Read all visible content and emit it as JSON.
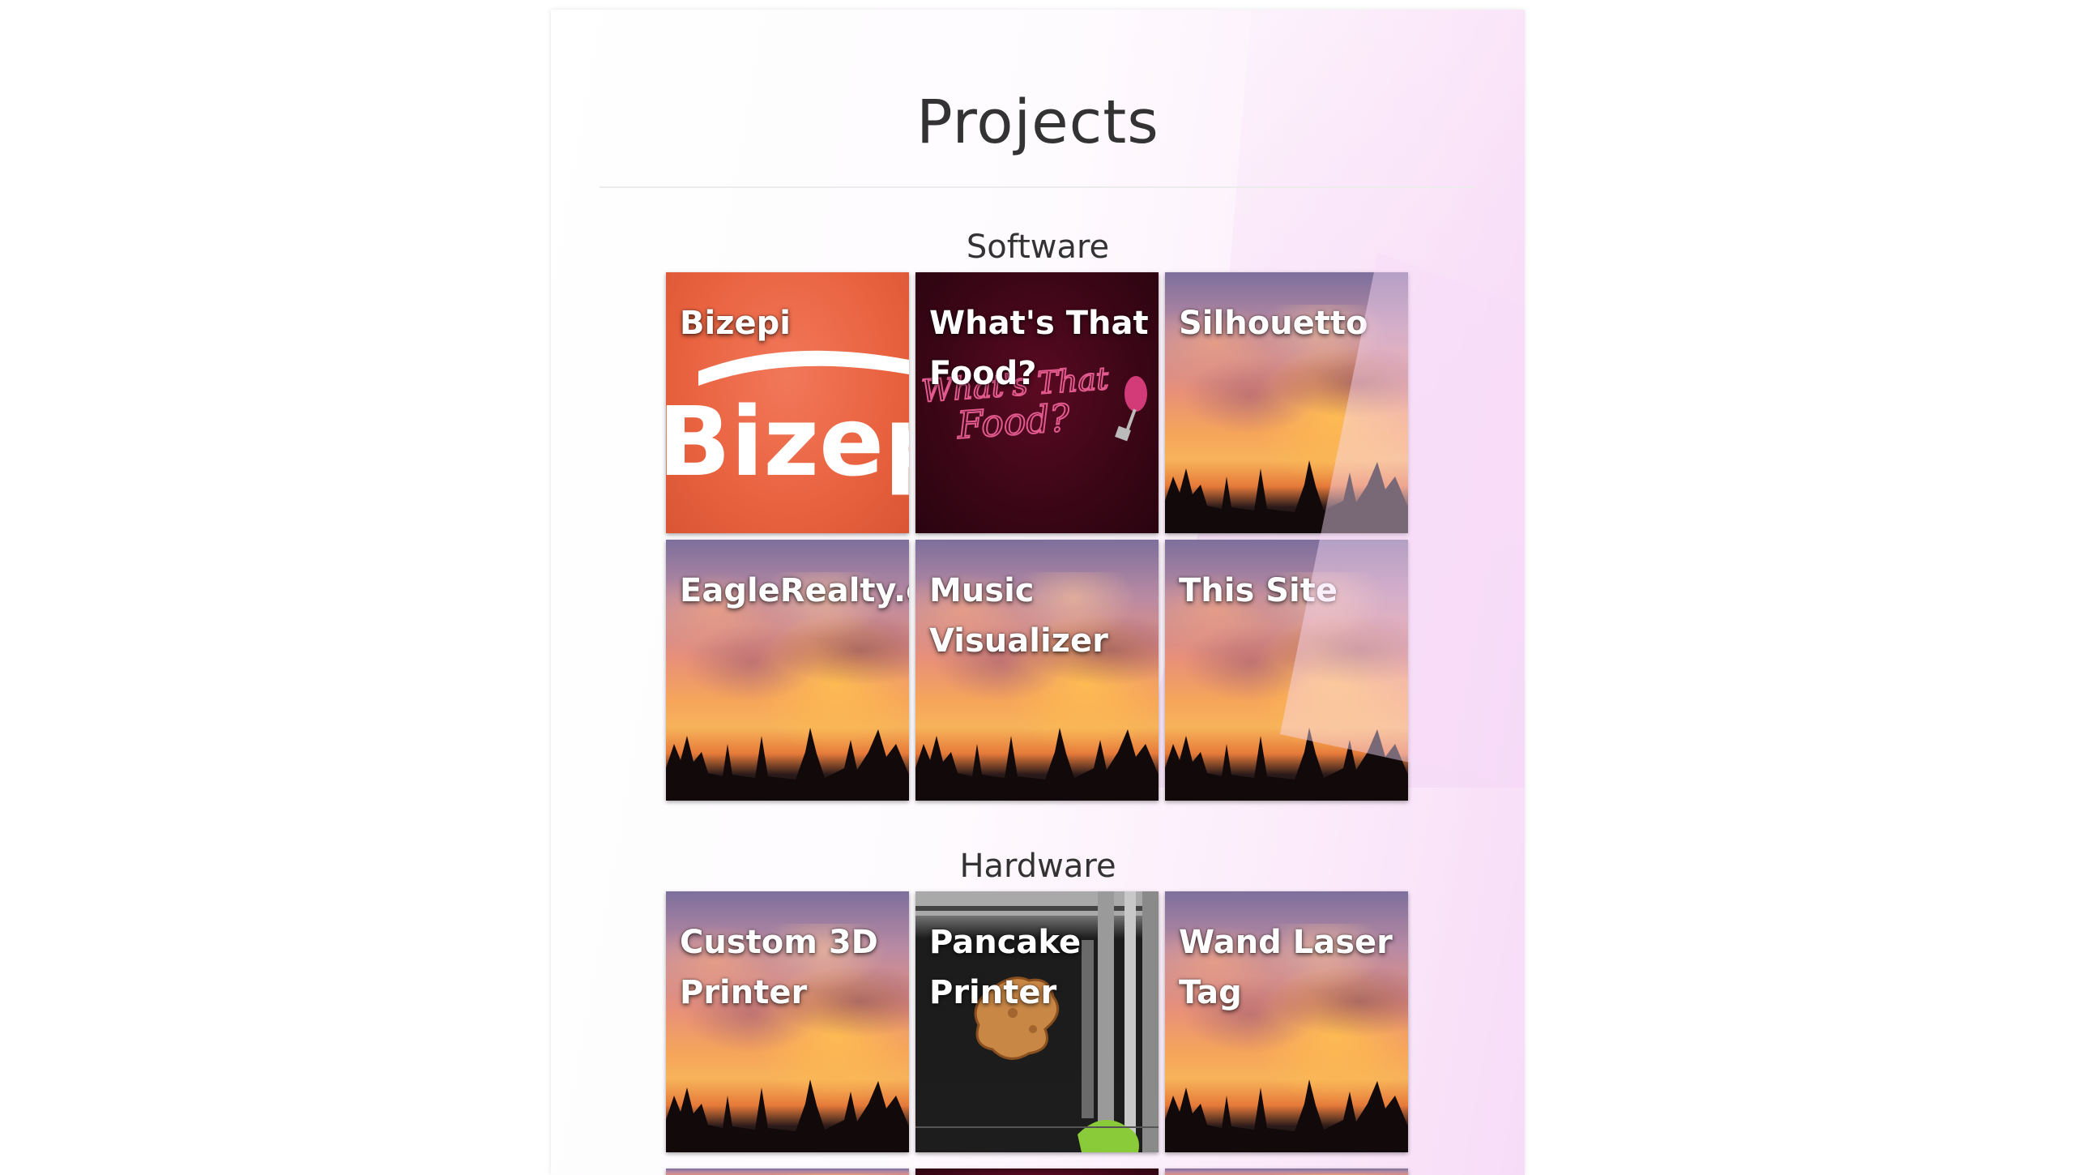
{
  "page": {
    "title": "Projects"
  },
  "sections": [
    {
      "title": "Software",
      "projects": [
        {
          "label": "Bizepi",
          "art_text": "Bizep"
        },
        {
          "label": "What's That Food?",
          "art_text_line1": "What's That",
          "art_text_line2": "Food?"
        },
        {
          "label": "Silhouetto"
        },
        {
          "label": "EagleRealty.c"
        },
        {
          "label": "Music Visualizer"
        },
        {
          "label": "This Site"
        }
      ]
    },
    {
      "title": "Hardware",
      "projects": [
        {
          "label": "Custom 3D Printer"
        },
        {
          "label": "Pancake Printer"
        },
        {
          "label": "Wand Laser Tag"
        }
      ]
    }
  ],
  "colors": {
    "bizepi_orange": "#e9623f",
    "food_maroon": "#3a0616",
    "heading_text": "#333333"
  }
}
